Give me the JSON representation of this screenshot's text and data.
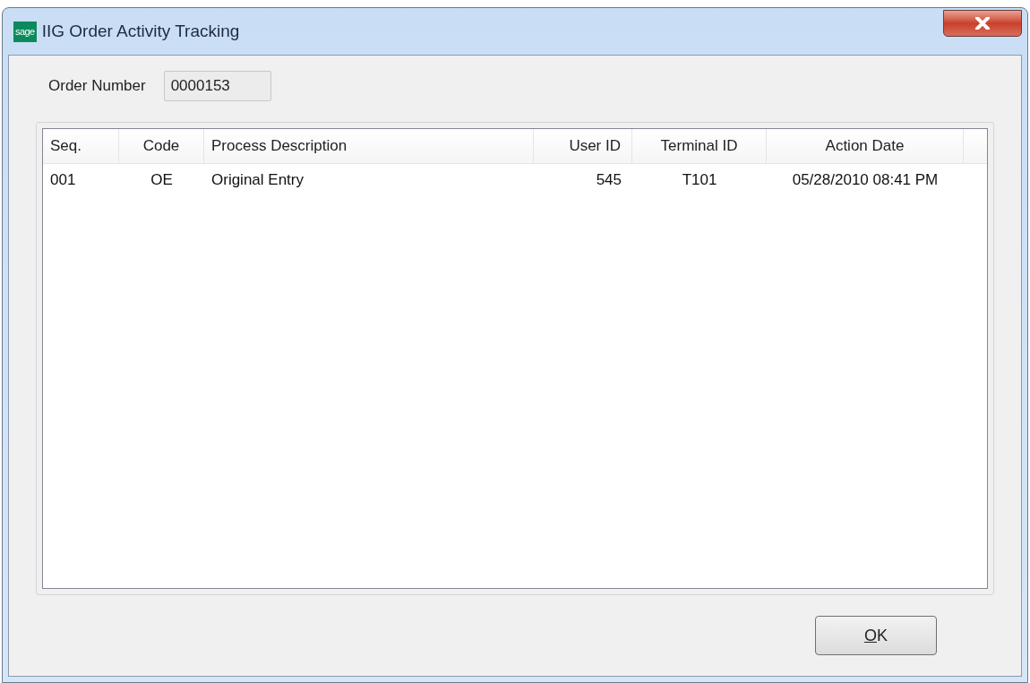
{
  "window": {
    "title": "IIG Order Activity Tracking",
    "logo": "sage"
  },
  "order_number": {
    "label": "Order Number",
    "value": "0000153"
  },
  "table": {
    "columns": [
      {
        "label": "Seq."
      },
      {
        "label": "Code"
      },
      {
        "label": "Process Description"
      },
      {
        "label": "User ID"
      },
      {
        "label": "Terminal ID"
      },
      {
        "label": "Action Date"
      }
    ],
    "rows": [
      {
        "cells": [
          "001",
          "OE",
          "Original Entry",
          "545",
          "T101",
          "05/28/2010 08:41 PM"
        ]
      }
    ]
  },
  "buttons": [
    {
      "label": "OK",
      "underline_first": true
    }
  ]
}
